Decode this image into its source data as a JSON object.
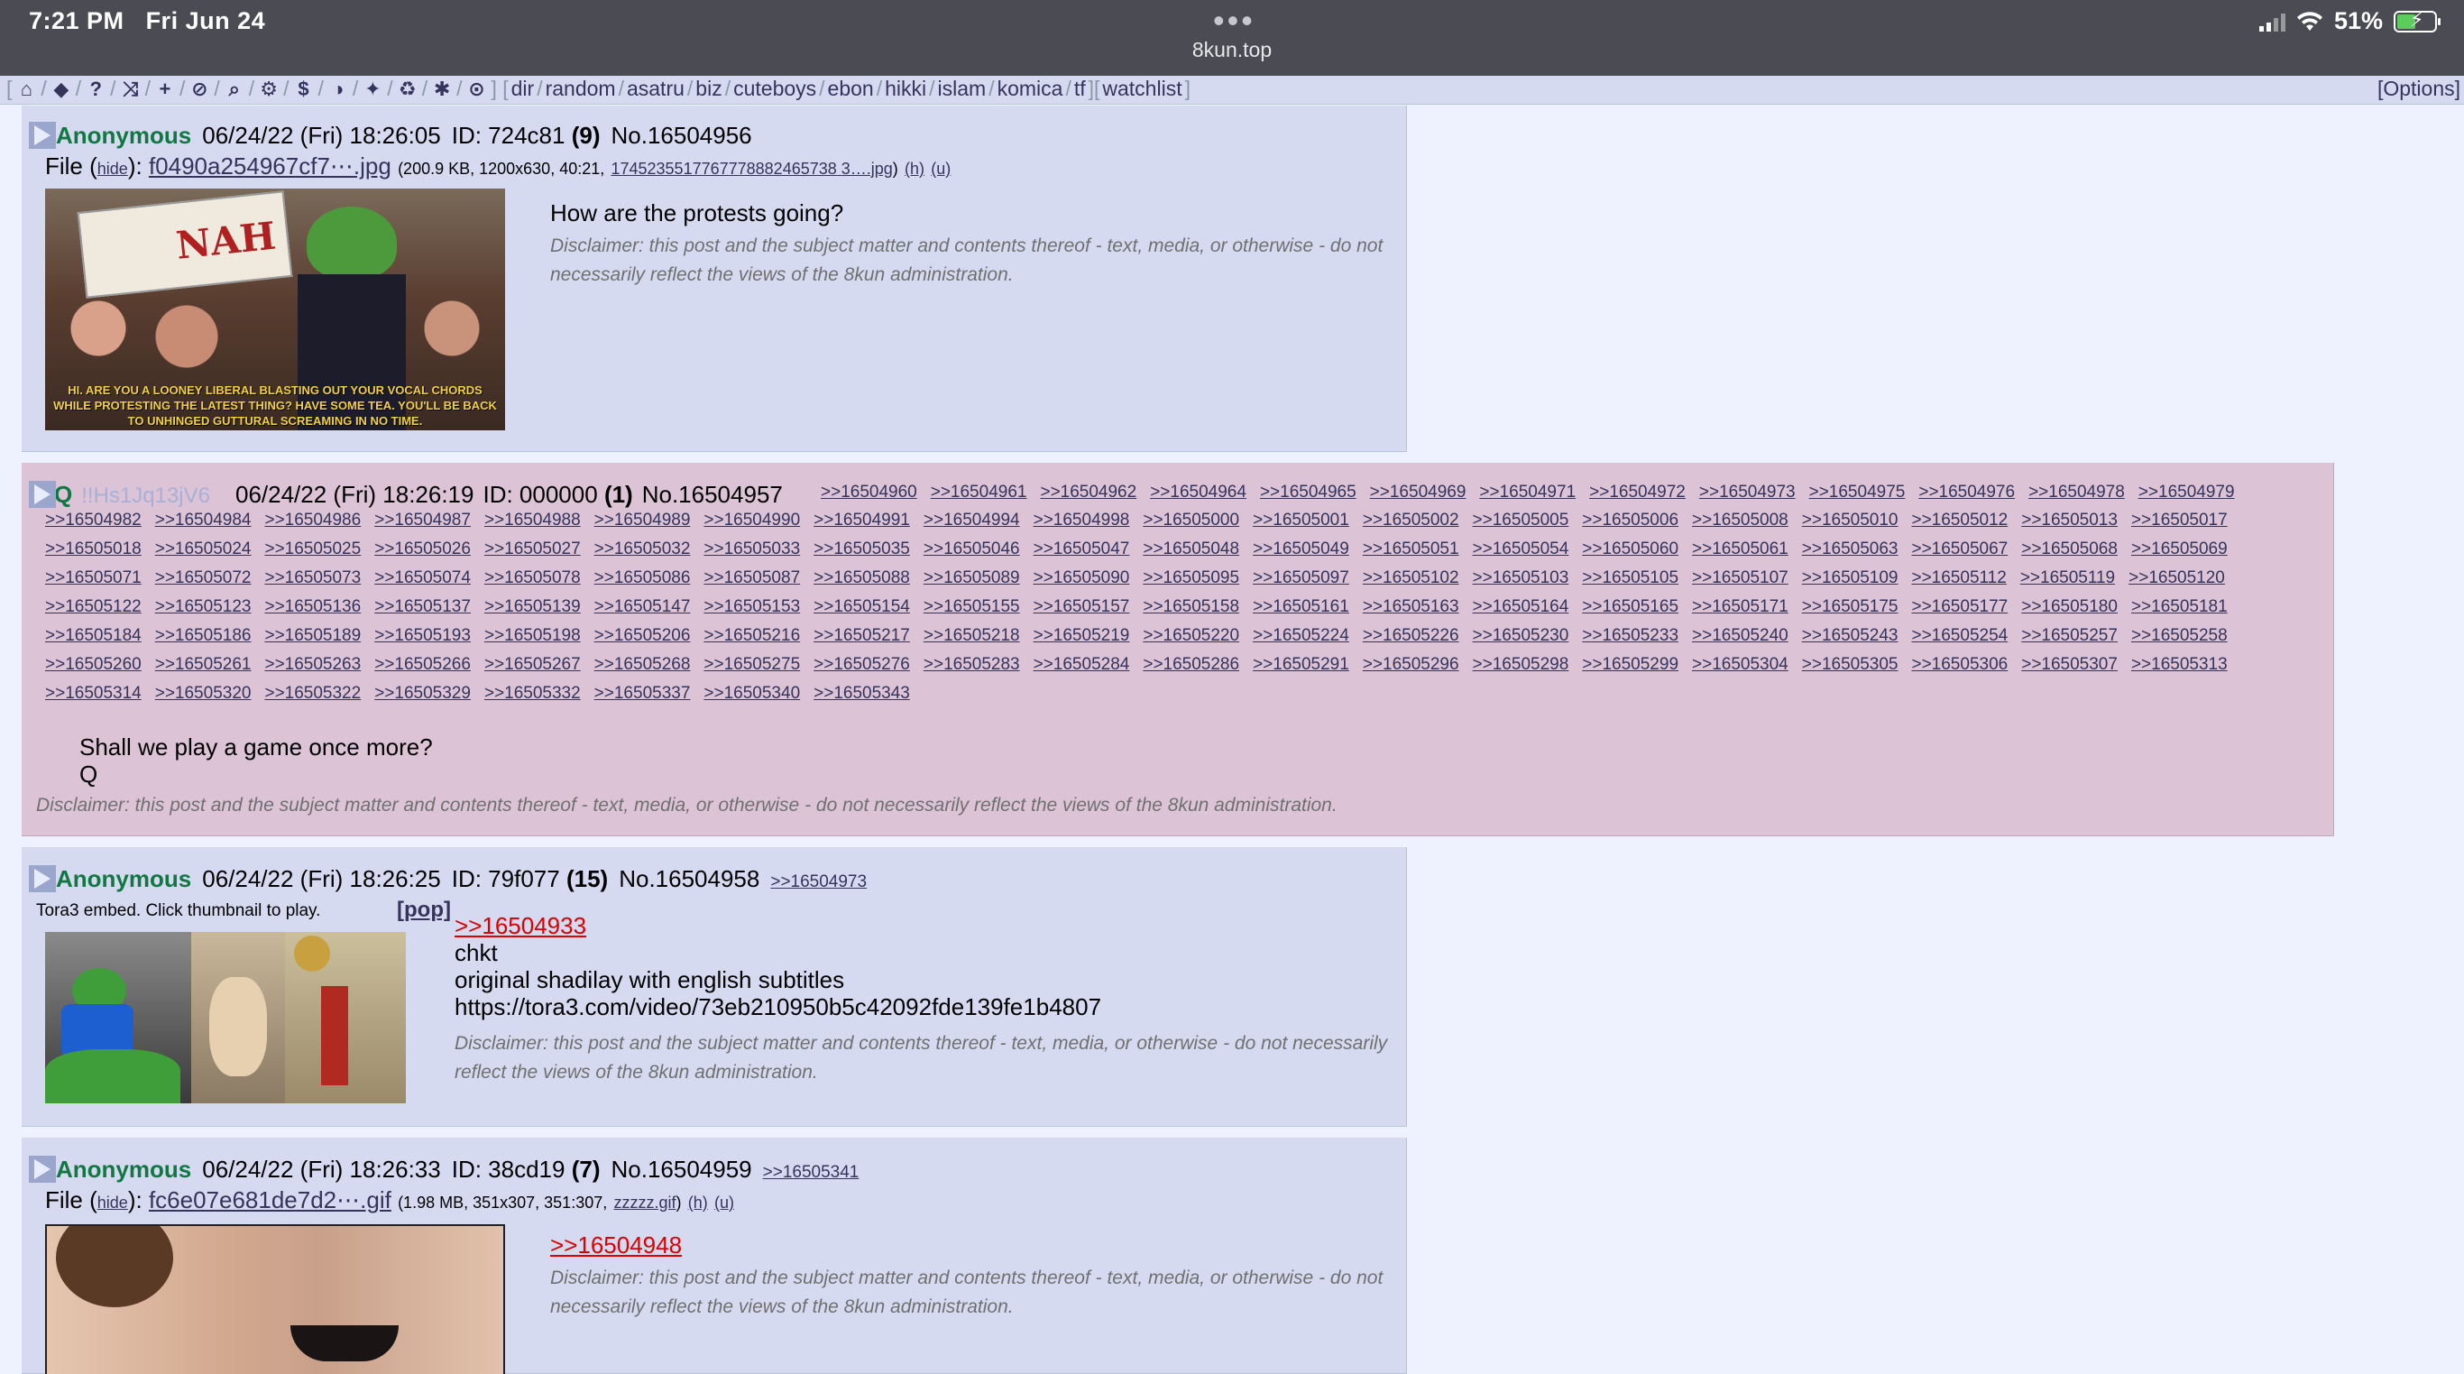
{
  "status": {
    "time": "7:21 PM",
    "date": "Fri Jun 24",
    "url": "8kun.top",
    "battery": "51%",
    "battery_level": 0.51
  },
  "boardlist": {
    "icons": [
      "home-icon",
      "tags-icon",
      "help-icon",
      "random-icon",
      "plus-icon",
      "ban-icon",
      "search-icon",
      "gear-icon",
      "dollar-icon",
      "contrast-icon",
      "twitter-icon",
      "recycle-icon",
      "bug-icon",
      "check-circle-icon"
    ],
    "boards": [
      "dir",
      "random",
      "asatru",
      "biz",
      "cuteboys",
      "ebon",
      "hikki",
      "islam",
      "komica",
      "tf"
    ],
    "watchlist": "watchlist",
    "options": "[Options]"
  },
  "posts": [
    {
      "name": "Anonymous",
      "date": "06/24/22 (Fri) 18:26:05",
      "id_label": "ID: 724c81",
      "count": "(9)",
      "number": "No.16504956",
      "file_prefix": "File (",
      "file_hide": "hide",
      "file_mid": "):",
      "file_name": "f0490a254967cf7⋯.jpg",
      "file_meta": "(200.9 KB, 1200x630, 40:21,",
      "file_orig": "1745235517767778882465738 3….jpg",
      "file_h": "(h)",
      "file_u": "(u)",
      "thumb_caption": "HI. ARE YOU A LOONEY LIBERAL BLASTING OUT YOUR VOCAL CHORDS WHILE PROTESTING THE LATEST THING? HAVE SOME TEA. YOU'LL BE BACK TO UNHINGED GUTTURAL SCREAMING IN NO TIME.",
      "thumb_sign": "NAH",
      "body": "How are the protests going?",
      "disclaimer": "Disclaimer: this post and the subject matter and contents thereof - text, media, or otherwise - do not necessarily reflect the views of the 8kun administration."
    },
    {
      "name": "Q",
      "trip": "!!Hs1Jq13jV6",
      "date": "06/24/22 (Fri) 18:26:19",
      "id_label": "ID: 000000",
      "count": "(1)",
      "number": "No.16504957",
      "backlinks": [
        ">>16504960",
        ">>16504961",
        ">>16504962",
        ">>16504964",
        ">>16504965",
        ">>16504969",
        ">>16504971",
        ">>16504972",
        ">>16504973",
        ">>16504975",
        ">>16504976",
        ">>16504978",
        ">>16504979",
        ">>16504982",
        ">>16504984",
        ">>16504986",
        ">>16504987",
        ">>16504988",
        ">>16504989",
        ">>16504990",
        ">>16504991",
        ">>16504994",
        ">>16504998",
        ">>16505000",
        ">>16505001",
        ">>16505002",
        ">>16505005",
        ">>16505006",
        ">>16505008",
        ">>16505010",
        ">>16505012",
        ">>16505013",
        ">>16505017",
        ">>16505018",
        ">>16505024",
        ">>16505025",
        ">>16505026",
        ">>16505027",
        ">>16505032",
        ">>16505033",
        ">>16505035",
        ">>16505046",
        ">>16505047",
        ">>16505048",
        ">>16505049",
        ">>16505051",
        ">>16505054",
        ">>16505060",
        ">>16505061",
        ">>16505063",
        ">>16505067",
        ">>16505068",
        ">>16505069",
        ">>16505071",
        ">>16505072",
        ">>16505073",
        ">>16505074",
        ">>16505078",
        ">>16505086",
        ">>16505087",
        ">>16505088",
        ">>16505089",
        ">>16505090",
        ">>16505095",
        ">>16505097",
        ">>16505102",
        ">>16505103",
        ">>16505105",
        ">>16505107",
        ">>16505109",
        ">>16505112",
        ">>16505119",
        ">>16505120",
        ">>16505122",
        ">>16505123",
        ">>16505136",
        ">>16505137",
        ">>16505139",
        ">>16505147",
        ">>16505153",
        ">>16505154",
        ">>16505155",
        ">>16505157",
        ">>16505158",
        ">>16505161",
        ">>16505163",
        ">>16505164",
        ">>16505165",
        ">>16505171",
        ">>16505175",
        ">>16505177",
        ">>16505180",
        ">>16505181",
        ">>16505184",
        ">>16505186",
        ">>16505189",
        ">>16505193",
        ">>16505198",
        ">>16505206",
        ">>16505216",
        ">>16505217",
        ">>16505218",
        ">>16505219",
        ">>16505220",
        ">>16505224",
        ">>16505226",
        ">>16505230",
        ">>16505233",
        ">>16505240",
        ">>16505243",
        ">>16505254",
        ">>16505257",
        ">>16505258",
        ">>16505260",
        ">>16505261",
        ">>16505263",
        ">>16505266",
        ">>16505267",
        ">>16505268",
        ">>16505275",
        ">>16505276",
        ">>16505283",
        ">>16505284",
        ">>16505286",
        ">>16505291",
        ">>16505296",
        ">>16505298",
        ">>16505299",
        ">>16505304",
        ">>16505305",
        ">>16505306",
        ">>16505307",
        ">>16505313",
        ">>16505314",
        ">>16505320",
        ">>16505322",
        ">>16505329",
        ">>16505332",
        ">>16505337",
        ">>16505340",
        ">>16505343"
      ],
      "body_line1": "Shall we play a game once more?",
      "body_line2": "Q",
      "disclaimer": "Disclaimer: this post and the subject matter and contents thereof - text, media, or otherwise - do not necessarily reflect the views of the 8kun administration."
    },
    {
      "name": "Anonymous",
      "date": "06/24/22 (Fri) 18:26:25",
      "id_label": "ID: 79f077",
      "count": "(15)",
      "number": "No.16504958",
      "backlink": ">>16504973",
      "embed_label": "Tora3 embed. Click thumbnail to play.",
      "pop": "[pop]",
      "quote": ">>16504933",
      "line1": "chkt",
      "line2": "original shadilay with english subtitles",
      "line3": "https://tora3.com/video/73eb210950b5c42092fde139fe1b4807",
      "disclaimer": "Disclaimer: this post and the subject matter and contents thereof - text, media, or otherwise - do not necessarily reflect the views of the 8kun administration."
    },
    {
      "name": "Anonymous",
      "date": "06/24/22 (Fri) 18:26:33",
      "id_label": "ID: 38cd19",
      "count": "(7)",
      "number": "No.16504959",
      "backlink": ">>16505341",
      "file_prefix": "File (",
      "file_hide": "hide",
      "file_mid": "):",
      "file_name": "fc6e07e681de7d2⋯.gif",
      "file_meta": "(1.98 MB, 351x307, 351:307,",
      "file_orig": "zzzzz.gif",
      "file_h": "(h)",
      "file_u": "(u)",
      "quote": ">>16504948",
      "disclaimer": "Disclaimer: this post and the subject matter and contents thereof - text, media, or otherwise - do not necessarily reflect the views of the 8kun administration."
    }
  ]
}
